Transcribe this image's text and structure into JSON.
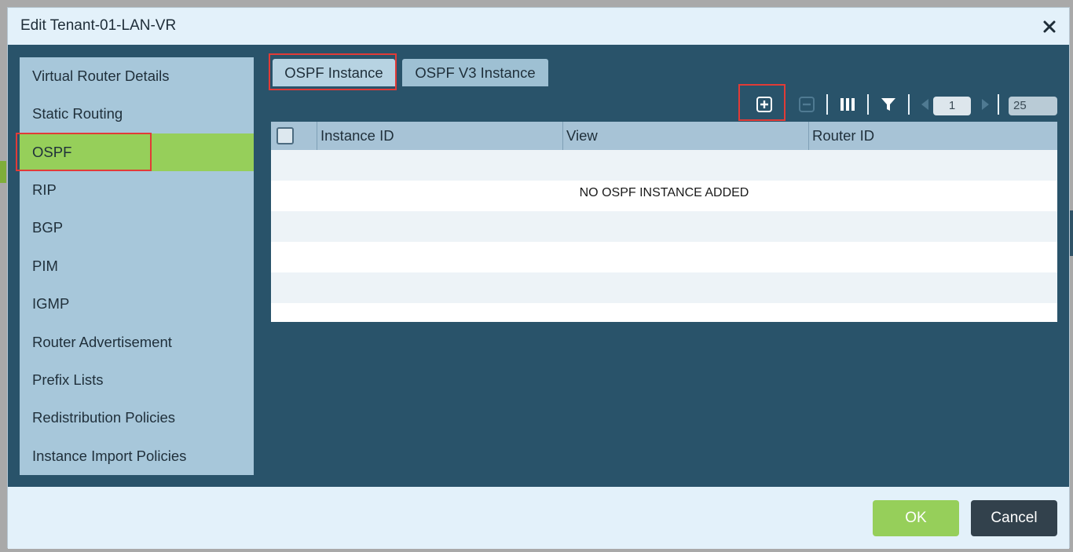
{
  "modal": {
    "title": "Edit Tenant-01-LAN-VR"
  },
  "side_nav": {
    "items": [
      {
        "label": "Virtual Router Details"
      },
      {
        "label": "Static Routing"
      },
      {
        "label": "OSPF"
      },
      {
        "label": "RIP"
      },
      {
        "label": "BGP"
      },
      {
        "label": "PIM"
      },
      {
        "label": "IGMP"
      },
      {
        "label": "Router Advertisement"
      },
      {
        "label": "Prefix Lists"
      },
      {
        "label": "Redistribution Policies"
      },
      {
        "label": "Instance Import Policies"
      }
    ],
    "active": "OSPF"
  },
  "tabs": [
    {
      "label": "OSPF Instance"
    },
    {
      "label": "OSPF V3 Instance"
    }
  ],
  "toolbar": {
    "page_number": "1",
    "page_size": "25"
  },
  "grid": {
    "columns": [
      "Instance ID",
      "View",
      "Router ID"
    ],
    "empty_message": "NO OSPF INSTANCE ADDED"
  },
  "footer": {
    "ok_label": "OK",
    "cancel_label": "Cancel"
  },
  "colors": {
    "accent_green": "#96cf5a",
    "panel_blue": "#29536a",
    "highlight_red": "#e23b37"
  }
}
